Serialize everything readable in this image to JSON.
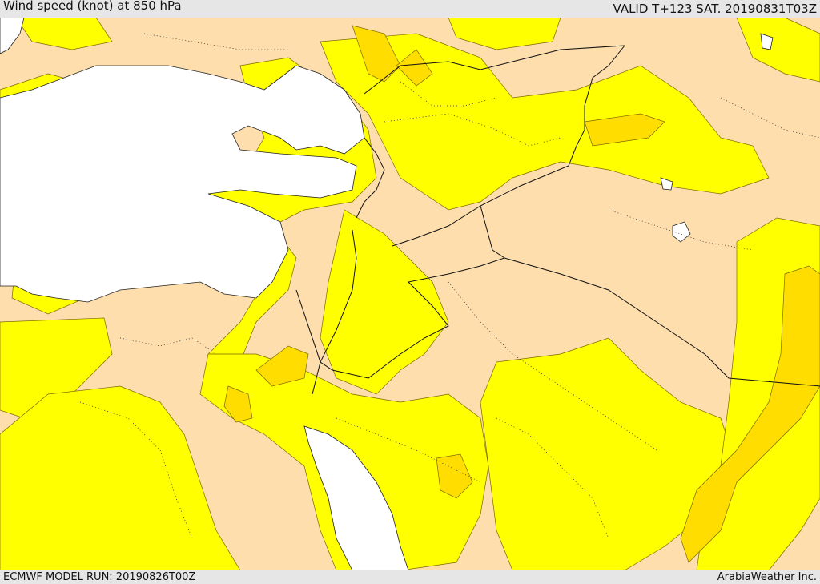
{
  "header": {
    "title": "Wind speed (knot) at 850 hPa",
    "valid": "VALID T+123 SAT. 20190831T03Z"
  },
  "footer": {
    "model_run": "ECMWF MODEL RUN: 20190826T00Z",
    "credit": "ArabiaWeather Inc."
  },
  "colors": {
    "land": "#fddeac",
    "sea": "#ffffff",
    "wind_low": "#ffff00",
    "wind_mid": "#ffdd00",
    "border": "#000000"
  }
}
